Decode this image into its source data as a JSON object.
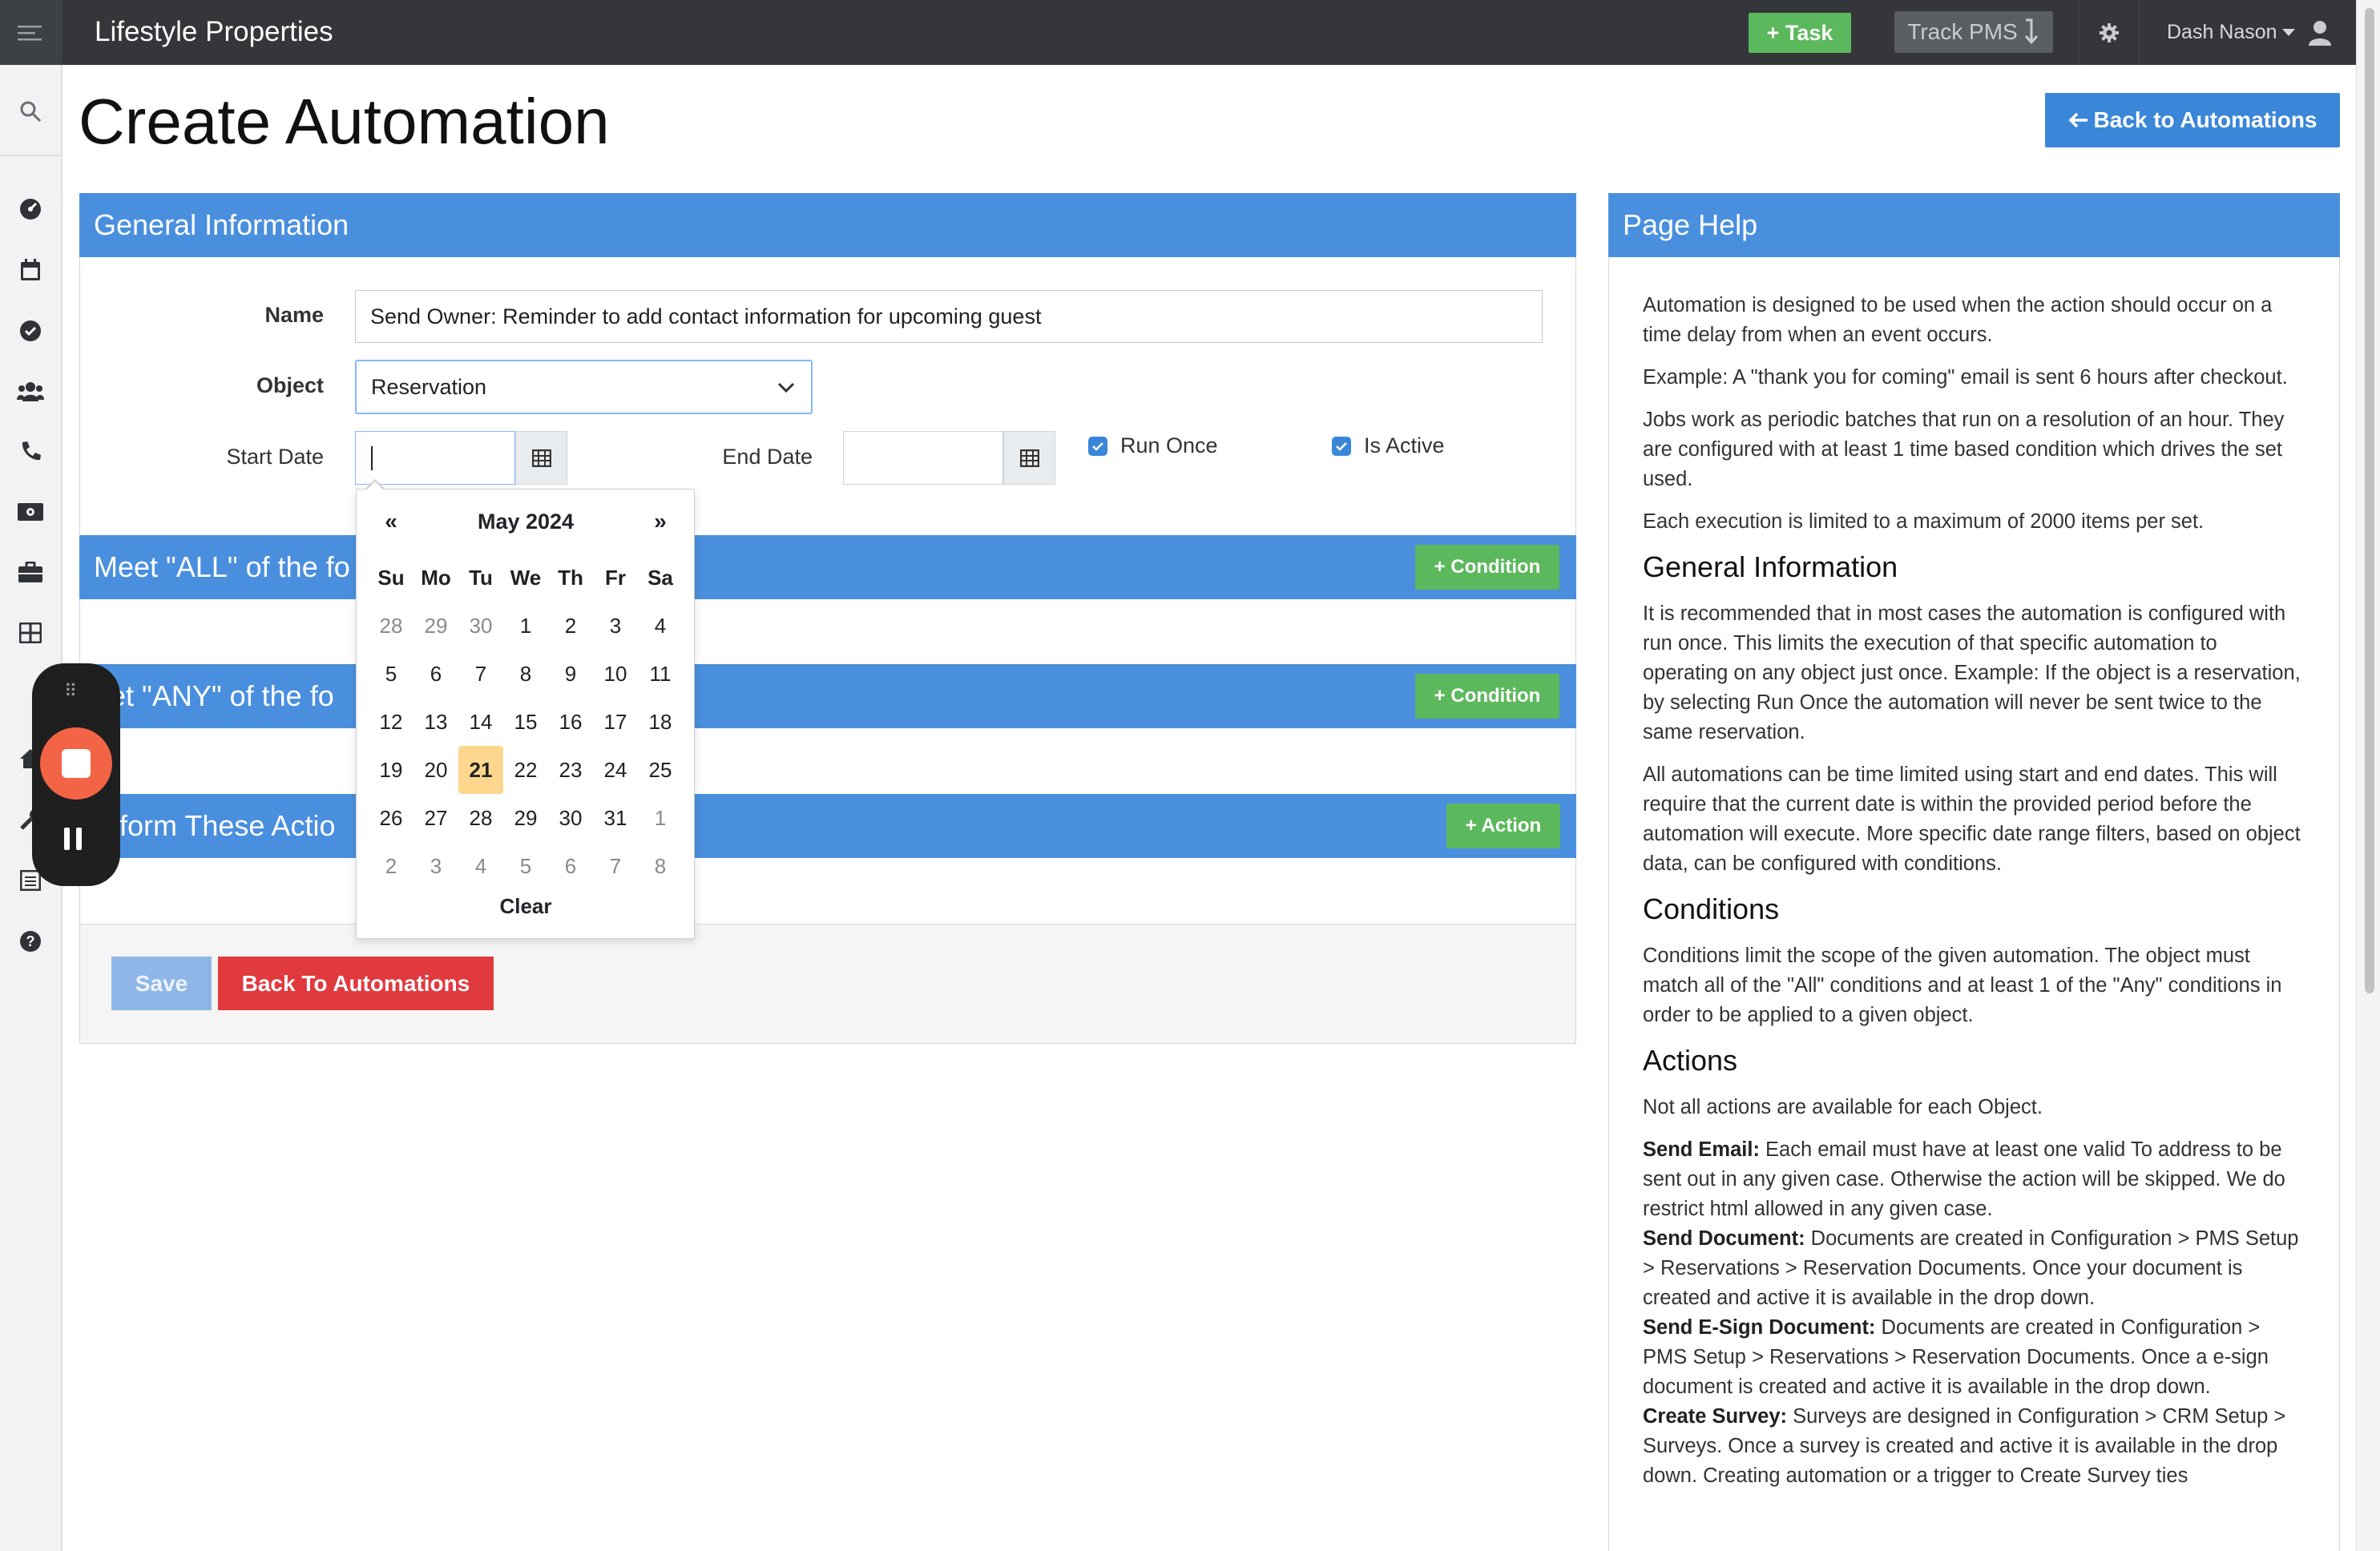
{
  "topbar": {
    "app_title": "Lifestyle Properties",
    "task_label": "+ Task",
    "track_label": "Track PMS",
    "user_name": "Dash Nason"
  },
  "page": {
    "title": "Create Automation",
    "back_top_label": "Back to Automations"
  },
  "general": {
    "heading": "General Information",
    "name_label": "Name",
    "name_value": "Send Owner: Reminder to add contact information for upcoming guest",
    "object_label": "Object",
    "object_value": "Reservation",
    "start_label": "Start Date",
    "end_label": "End Date",
    "run_once_label": "Run Once",
    "is_active_label": "Is Active"
  },
  "sections": {
    "all_heading": "Meet \"ALL\" of the fo",
    "any_heading": "eet \"ANY\" of the fo",
    "actions_heading": "erform These Actio",
    "condition_btn": "+ Condition",
    "action_btn": "+ Action"
  },
  "footer": {
    "save_label": "Save",
    "back_label": "Back To Automations"
  },
  "datepicker": {
    "prev": "«",
    "next": "»",
    "month_title": "May 2024",
    "clear": "Clear",
    "dow": [
      "Su",
      "Mo",
      "Tu",
      "We",
      "Th",
      "Fr",
      "Sa"
    ],
    "weeks": [
      [
        [
          "28",
          1
        ],
        [
          "29",
          1
        ],
        [
          "30",
          1
        ],
        [
          "1",
          0
        ],
        [
          "2",
          0
        ],
        [
          "3",
          0
        ],
        [
          "4",
          0
        ]
      ],
      [
        [
          "5",
          0
        ],
        [
          "6",
          0
        ],
        [
          "7",
          0
        ],
        [
          "8",
          0
        ],
        [
          "9",
          0
        ],
        [
          "10",
          0
        ],
        [
          "11",
          0
        ]
      ],
      [
        [
          "12",
          0
        ],
        [
          "13",
          0
        ],
        [
          "14",
          0
        ],
        [
          "15",
          0
        ],
        [
          "16",
          0
        ],
        [
          "17",
          0
        ],
        [
          "18",
          0
        ]
      ],
      [
        [
          "19",
          0
        ],
        [
          "20",
          0
        ],
        [
          "21",
          2
        ],
        [
          "22",
          0
        ],
        [
          "23",
          0
        ],
        [
          "24",
          0
        ],
        [
          "25",
          0
        ]
      ],
      [
        [
          "26",
          0
        ],
        [
          "27",
          0
        ],
        [
          "28",
          0
        ],
        [
          "29",
          0
        ],
        [
          "30",
          0
        ],
        [
          "31",
          0
        ],
        [
          "1",
          1
        ]
      ],
      [
        [
          "2",
          1
        ],
        [
          "3",
          1
        ],
        [
          "4",
          1
        ],
        [
          "5",
          1
        ],
        [
          "6",
          1
        ],
        [
          "7",
          1
        ],
        [
          "8",
          1
        ]
      ]
    ],
    "today_color": "#fdd78e"
  },
  "help": {
    "heading": "Page Help",
    "intro": [
      "Automation is designed to be used when the action should occur on a time delay from when an event occurs.",
      "Example: A \"thank you for coming\" email is sent 6 hours after checkout.",
      "Jobs work as periodic batches that run on a resolution of an hour. They are configured with at least 1 time based condition which drives the set used.",
      "Each execution is limited to a maximum of 2000 items per set."
    ],
    "general_heading": "General Information",
    "general_paras": [
      "It is recommended that in most cases the automation is configured with run once. This limits the execution of that specific automation to operating on any object just once. Example: If the object is a reservation, by selecting Run Once the automation will never be sent twice to the same reservation.",
      "All automations can be time limited using start and end dates. This will require that the current date is within the provided period before the automation will execute. More specific date range filters, based on object data, can be configured with conditions."
    ],
    "conditions_heading": "Conditions",
    "conditions_para": "Conditions limit the scope of the given automation. The object must match all of the \"All\" conditions and at least 1 of the \"Any\" conditions in order to be applied to a given object.",
    "actions_heading": "Actions",
    "actions_intro": "Not all actions are available for each Object.",
    "actions": [
      {
        "term": "Send Email:",
        "text": " Each email must have at least one valid To address to be sent out in any given case. Otherwise the action will be skipped. We do restrict html allowed in any given case."
      },
      {
        "term": "Send Document:",
        "text": " Documents are created in Configuration > PMS Setup > Reservations > Reservation Documents. Once your document is created and active it is available in the drop down."
      },
      {
        "term": "Send E-Sign Document:",
        "text": " Documents are created in Configuration > PMS Setup > Reservations > Reservation Documents. Once a e-sign document is created and active it is available in the drop down."
      },
      {
        "term": "Create Survey:",
        "text": " Surveys are designed in Configuration > CRM Setup > Surveys. Once a survey is created and active it is available in the drop down. Creating automation or a trigger to Create Survey ties"
      }
    ]
  },
  "colors": {
    "topbar": "#34363a",
    "panel_header": "#4a8fde",
    "green": "#5cb85c",
    "danger": "#e0393e",
    "recorder_stop": "#f26445"
  }
}
